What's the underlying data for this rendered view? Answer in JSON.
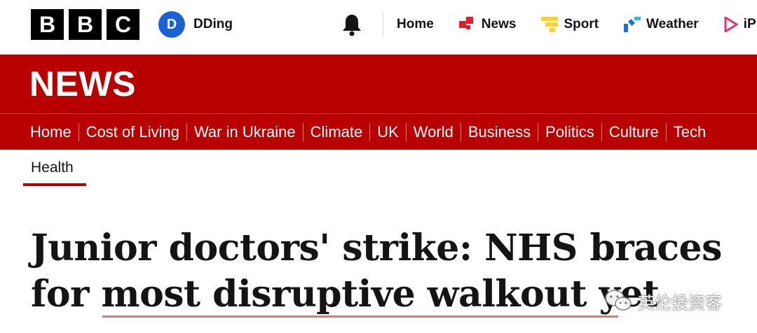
{
  "brand": {
    "logo_letters": [
      "B",
      "B",
      "C"
    ]
  },
  "account": {
    "initial": "D",
    "name": "DDing"
  },
  "top_nav": [
    {
      "label": "Home",
      "icon": "none"
    },
    {
      "label": "News",
      "icon": "news-icon"
    },
    {
      "label": "Sport",
      "icon": "sport-icon"
    },
    {
      "label": "Weather",
      "icon": "weather-icon"
    },
    {
      "label": "iPl",
      "icon": "iplayer-icon"
    }
  ],
  "banner": {
    "title": "NEWS"
  },
  "sub_nav": [
    "Home",
    "Cost of Living",
    "War in Ukraine",
    "Climate",
    "UK",
    "World",
    "Business",
    "Politics",
    "Culture",
    "Tech"
  ],
  "section": {
    "active": "Health"
  },
  "article": {
    "headline_line1": "Junior doctors' strike: NHS braces",
    "headline_line2": "for most disruptive walkout yet"
  },
  "watermark": {
    "text": "英伦投资客"
  },
  "colors": {
    "brand_red": "#b80000",
    "avatar_blue": "#1862d6",
    "news_icon": "#e41e26",
    "sport_icon": "#ffd230",
    "weather_icon": "#1a74ce",
    "iplayer_icon": "#e4307c"
  }
}
